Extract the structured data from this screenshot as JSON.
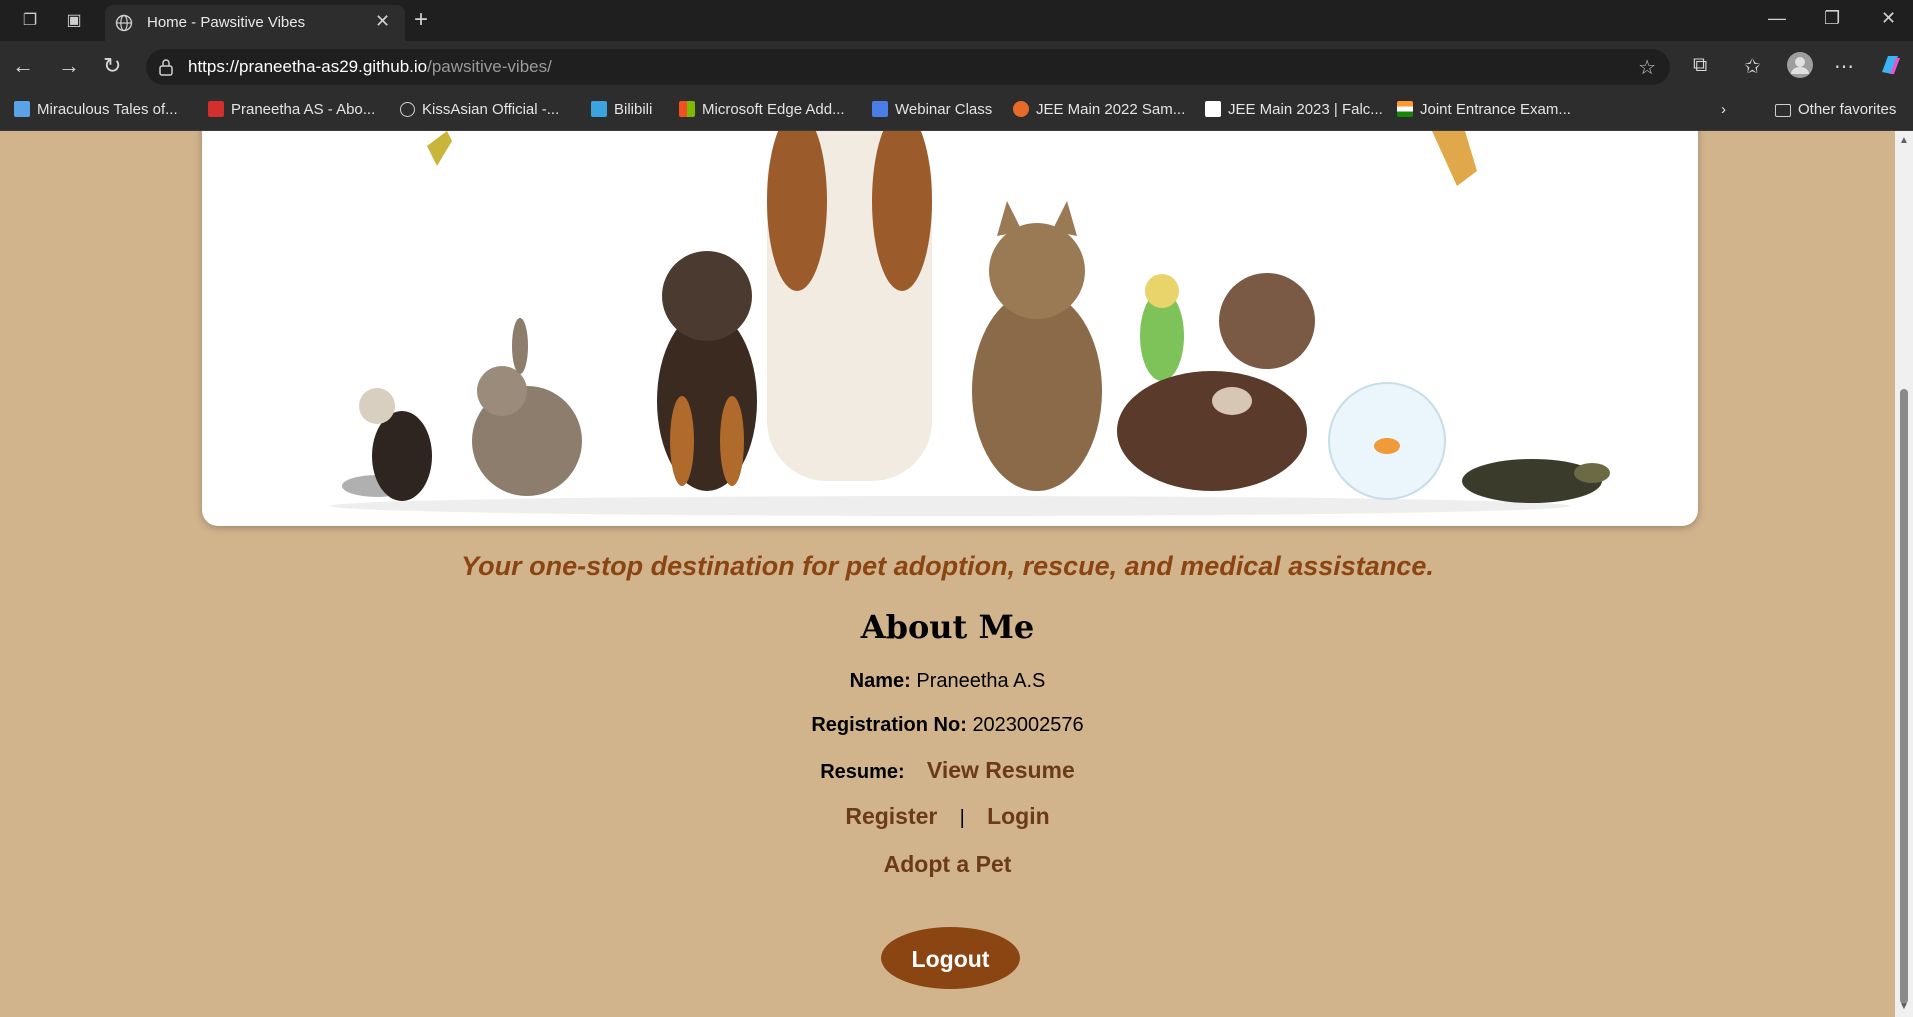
{
  "browser": {
    "tab_title": "Home - Pawsitive Vibes",
    "url_host": "https://praneetha-as29.github.io",
    "url_path": "/pawsitive-vibes/",
    "bookmarks": [
      "Miraculous Tales of...",
      "Praneetha AS - Abo...",
      "KissAsian Official -...",
      "Bilibili",
      "Microsoft Edge Add...",
      "Webinar Class",
      "JEE Main 2022 Sam...",
      "JEE Main 2023 | Falc...",
      "Joint Entrance Exam..."
    ],
    "other_favorites": "Other favorites"
  },
  "page": {
    "tagline": "Your one-stop destination for pet adoption, rescue, and medical assistance.",
    "about_heading": "About Me",
    "name_label": "Name:",
    "name_value": "Praneetha A.S",
    "reg_label": "Registration No:",
    "reg_value": "2023002576",
    "resume_label": "Resume:",
    "resume_link": "View Resume",
    "register_link": "Register",
    "separator": "|",
    "login_link": "Login",
    "adopt_link": "Adopt a Pet",
    "logout_button": "Logout"
  },
  "colors": {
    "page_bg": "#d2b48c",
    "accent_brown": "#8b4513",
    "link_brown": "#6b3a16"
  }
}
